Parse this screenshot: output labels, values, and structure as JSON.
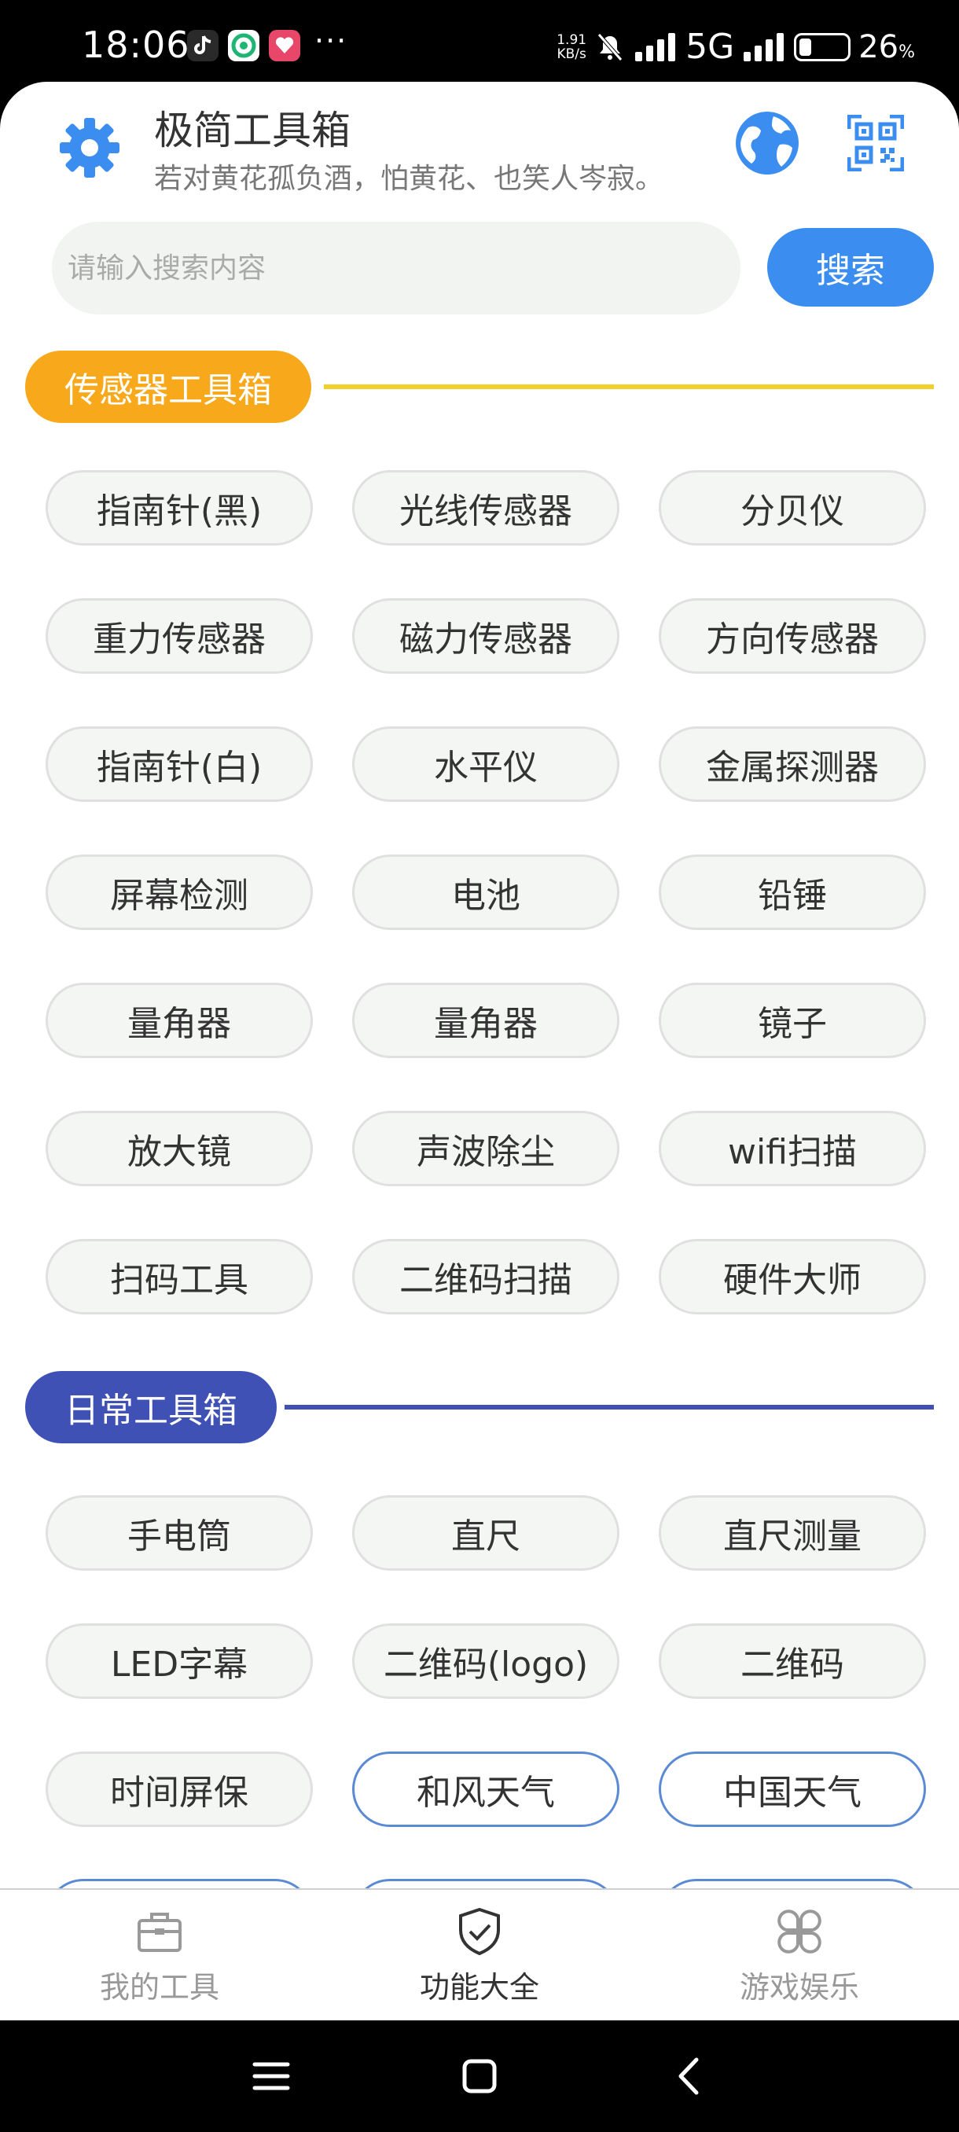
{
  "status_bar": {
    "time": "18:06",
    "net_speed_value": "1.91",
    "net_speed_unit": "KB/s",
    "network": "5G",
    "battery_percent": "26",
    "battery_percent_sign": "%",
    "more": "···",
    "battery_level": 0.26
  },
  "header": {
    "title": "极简工具箱",
    "subtitle": "若对黄花孤负酒，怕黄花、也笑人岑寂。",
    "icons": [
      "gear-icon",
      "globe-icon",
      "qr-scan-icon"
    ],
    "accent_color": "#3b8ef0"
  },
  "search": {
    "placeholder": "请输入搜索内容",
    "value": "",
    "button_label": "搜索"
  },
  "sections": [
    {
      "title": "传感器工具箱",
      "color": "#f7a81b",
      "line_color": "#f2d02a",
      "items": [
        "指南针(黑)",
        "光线传感器",
        "分贝仪",
        "重力传感器",
        "磁力传感器",
        "方向传感器",
        "指南针(白)",
        "水平仪",
        "金属探测器",
        "屏幕检测",
        "电池",
        "铅锤",
        "量角器",
        "量角器",
        "镜子",
        "放大镜",
        "声波除尘",
        "wifi扫描",
        "扫码工具",
        "二维码扫描",
        "硬件大师"
      ]
    },
    {
      "title": "日常工具箱",
      "color": "#3f51b5",
      "line_color": "#3f51b5",
      "items": [
        "手电筒",
        "直尺",
        "直尺测量",
        "LED字幕",
        "二维码(logo)",
        "二维码",
        "时间屏保",
        "和风天气",
        "中国天气"
      ]
    }
  ],
  "bottom_nav": [
    {
      "label": "我的工具",
      "icon": "toolbox-icon",
      "active": false
    },
    {
      "label": "功能大全",
      "icon": "shield-check-icon",
      "active": true
    },
    {
      "label": "游戏娱乐",
      "icon": "grid-apps-icon",
      "active": false
    }
  ],
  "system_nav": [
    "menu-icon",
    "home-icon",
    "back-icon"
  ]
}
